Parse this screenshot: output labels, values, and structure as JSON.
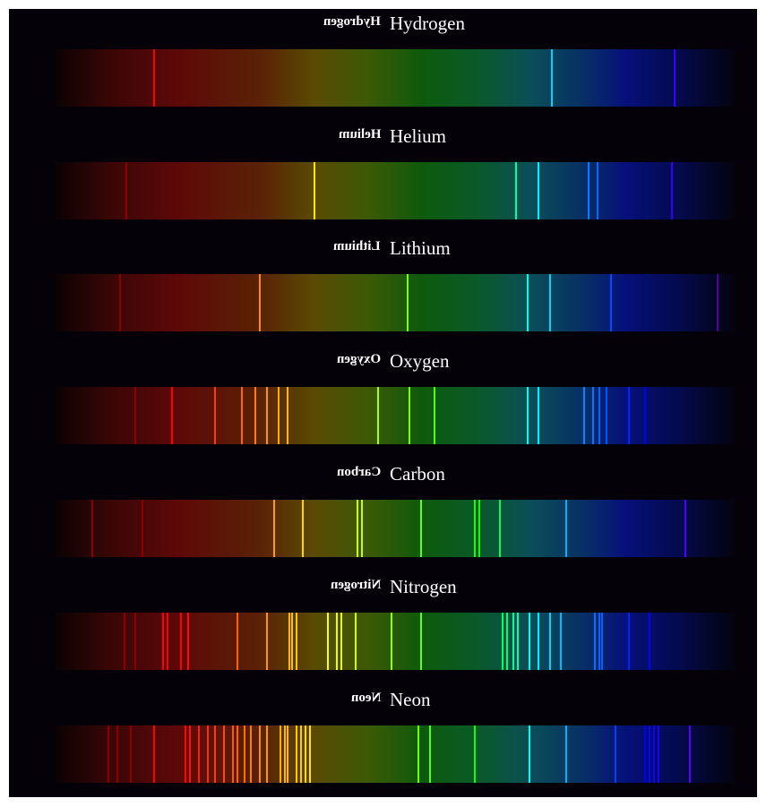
{
  "wavelength_axis_nm": [
    700,
    400
  ],
  "spectra": [
    {
      "element": "Hydrogen",
      "lines_nm": [
        657,
        481,
        427
      ]
    },
    {
      "element": "Helium",
      "lines_nm": [
        669,
        586,
        497,
        487,
        465,
        461,
        428
      ]
    },
    {
      "element": "Lithium",
      "lines_nm": [
        672,
        610,
        545,
        492,
        482,
        455,
        408
      ]
    },
    {
      "element": "Oxygen",
      "lines_nm": [
        665,
        649,
        630,
        618,
        612,
        607,
        602,
        598,
        558,
        544,
        533,
        492,
        487,
        467,
        463,
        460,
        457,
        447,
        440
      ]
    },
    {
      "element": "Carbon",
      "lines_nm": [
        684,
        662,
        604,
        591,
        567,
        565,
        539,
        515,
        513,
        504,
        475,
        422
      ]
    },
    {
      "element": "Nitrogen",
      "lines_nm": [
        670,
        665,
        653,
        651,
        645,
        642,
        620,
        607,
        597,
        596,
        594,
        580,
        576,
        574,
        568,
        552,
        539,
        503,
        501,
        498,
        496,
        491,
        487,
        482,
        477,
        462,
        460,
        459,
        447,
        438
      ]
    },
    {
      "element": "Neon",
      "lines_nm": [
        677,
        673,
        667,
        657,
        643,
        641,
        637,
        633,
        630,
        626,
        622,
        620,
        617,
        614,
        610,
        607,
        601,
        599,
        598,
        594,
        592,
        590,
        588,
        540,
        535,
        515,
        491,
        475,
        453,
        440,
        438,
        436,
        434,
        420
      ]
    }
  ]
}
